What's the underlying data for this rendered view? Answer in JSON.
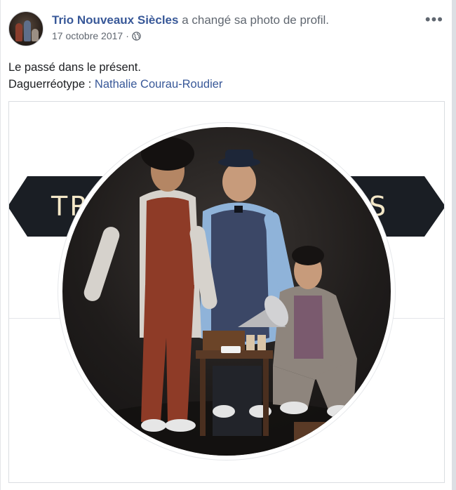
{
  "post": {
    "page_name": "Trio Nouveaux Siècles",
    "action": "a changé sa photo de profil.",
    "date": "17 octobre 2017",
    "date_separator": "·",
    "privacy_icon": "globe-icon",
    "more_label": "•••",
    "more_icon": "more-options-icon"
  },
  "content": {
    "line1": "Le passé dans le présent.",
    "credit_prefix": "Daguerréotype : ",
    "credit_link": "Nathalie Courau-Roudier"
  },
  "cover": {
    "banner_left_text": "TR",
    "banner_right_text": "ES"
  },
  "colors": {
    "link": "#385898",
    "meta": "#606770",
    "banner": "#1a1e24",
    "banner_text": "#f3e7c7"
  }
}
